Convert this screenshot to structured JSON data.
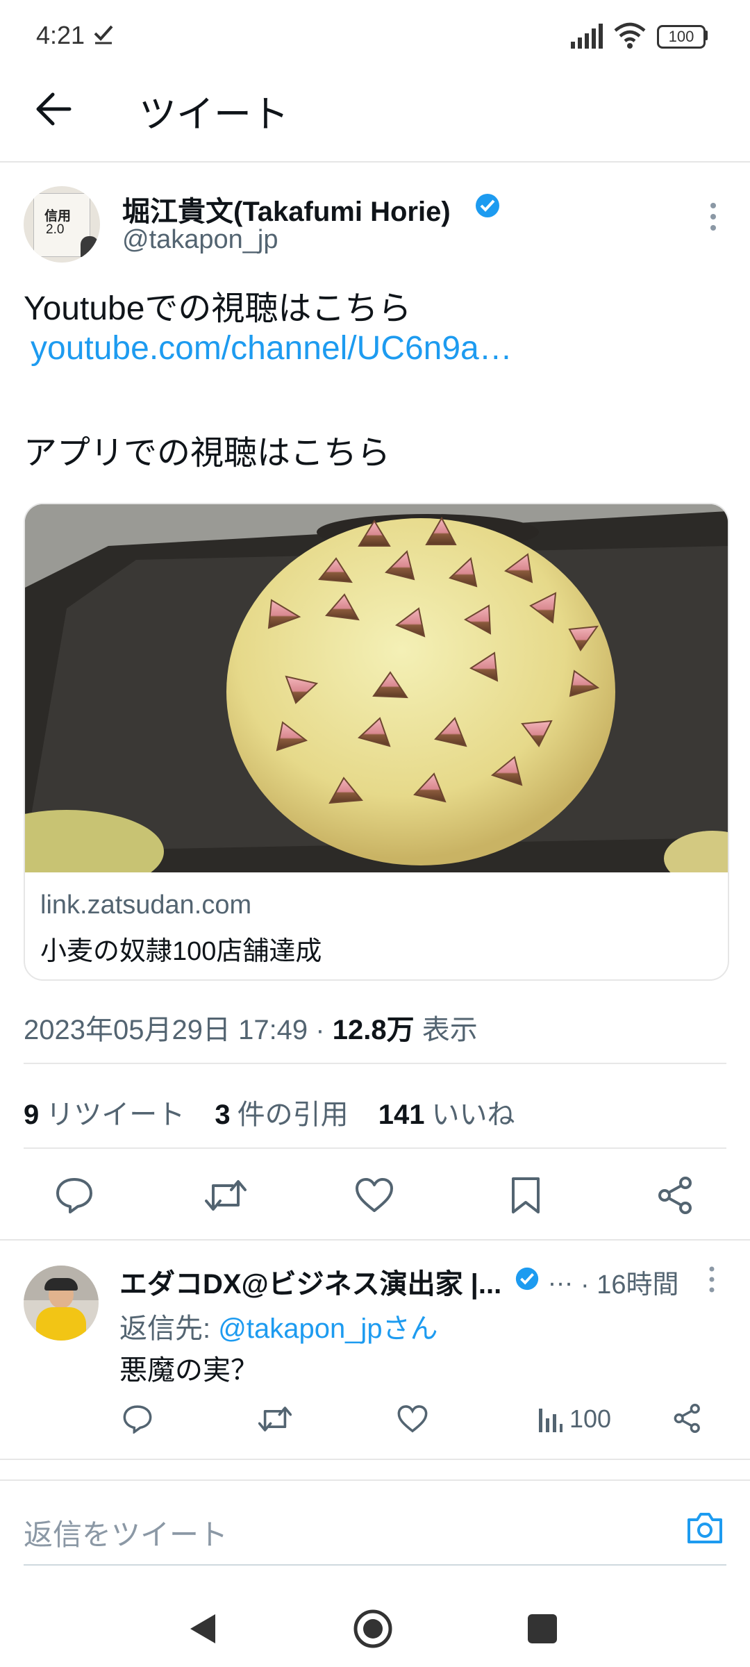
{
  "status_bar": {
    "time": "4:21",
    "battery": "100"
  },
  "header": {
    "title": "ツイート"
  },
  "tweet": {
    "author_name": "堀江貴文(Takafumi Horie)",
    "author_handle": "@takapon_jp",
    "avatar_text_line1": "信用",
    "avatar_text_line2": "2.0",
    "text_line1": "Youtubeでの視聴はこちら",
    "link": "youtube.com/channel/UC6n9a…",
    "text_line2": "アプリでの視聴はこちら",
    "card": {
      "domain": "link.zatsudan.com",
      "title": "小麦の奴隷100店舗達成"
    },
    "timestamp": "2023年05月29日 17:49",
    "separator": " · ",
    "views_count": "12.8万",
    "views_label": "表示",
    "stats": {
      "retweets_count": "9",
      "retweets_label": "リツイート",
      "quotes_count": "3",
      "quotes_label": "件の引用",
      "likes_count": "141",
      "likes_label": "いいね"
    }
  },
  "reply": {
    "author_name": "エダコDX@ビジネス演出家 |...",
    "ellipsis": "…",
    "time": "· 16時間",
    "reply_to_prefix": "返信先: ",
    "reply_to_handle": "@takapon_jpさん",
    "text": "悪魔の実？",
    "views": "100"
  },
  "composer": {
    "placeholder": "返信をツイート"
  },
  "colors": {
    "accent": "#1d9bf0",
    "text": "#0f1419",
    "muted": "#536471"
  }
}
